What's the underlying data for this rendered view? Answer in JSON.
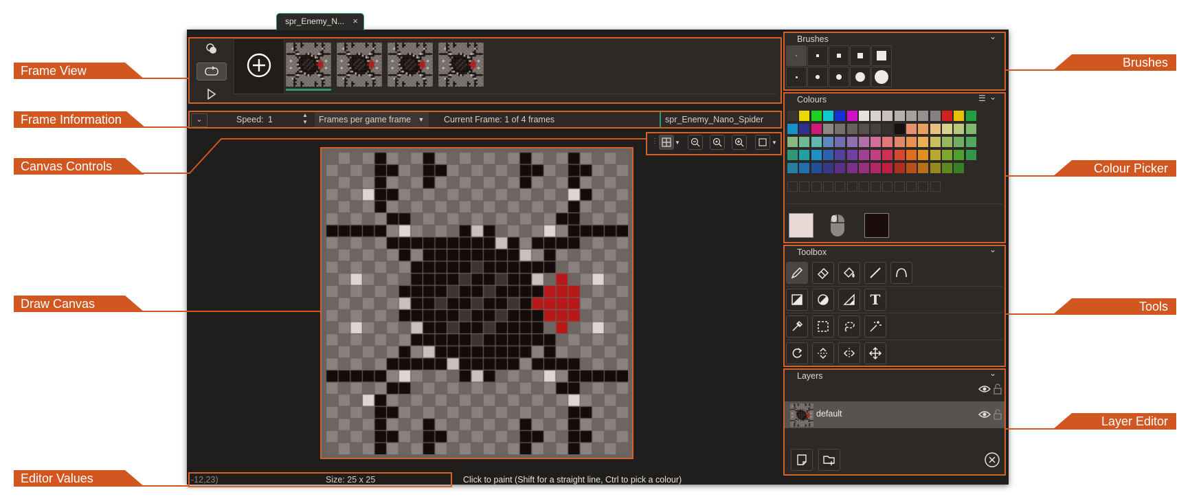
{
  "tab": {
    "title": "spr_Enemy_N...",
    "close": "×"
  },
  "callouts": {
    "frame_view": "Frame View",
    "frame_information": "Frame Information",
    "canvas_controls": "Canvas Controls",
    "draw_canvas": "Draw Canvas",
    "editor_values": "Editor Values",
    "brushes": "Brushes",
    "colour_picker": "Colour Picker",
    "tools": "Tools",
    "layer_editor": "Layer Editor"
  },
  "frame_info": {
    "speed_label": "Speed:",
    "speed_value": "1",
    "speed_mode": "Frames per game frame",
    "current_frame": "Current Frame: 1 of 4 frames",
    "sprite_name": "spr_Enemy_Nano_Spider"
  },
  "frame_view": {
    "frame_count": 4,
    "selected_frame": 1
  },
  "panels": {
    "brushes": "Brushes",
    "colours": "Colours",
    "toolbox": "Toolbox",
    "layers": "Layers"
  },
  "layers": [
    {
      "name": "default",
      "visible": true,
      "locked": false
    }
  ],
  "status": {
    "cursor": "-12,23)",
    "size": "Size: 25 x 25",
    "hint": "Click to paint (Shift for a straight line, Ctrl to pick a colour)"
  },
  "colours": {
    "palette": [
      [
        "#3a3532",
        "#e8d800",
        "#20d020",
        "#10c8d0",
        "#1830d8",
        "#d010c8",
        "#e8e0dc",
        "#d8d0cc",
        "#c8c0bc",
        "#b8b0ac",
        "#a8a09c",
        "#989090",
        "#888080",
        "#d02020",
        "#e8c000",
        "#20a040"
      ],
      [
        "#1890c8",
        "#303090",
        "#d01878",
        "#908888",
        "#787070",
        "#686060",
        "#585050",
        "#484040",
        "#383030",
        "#181010",
        "#e89070",
        "#e8a060",
        "#e8c080",
        "#d8d090",
        "#b8c880",
        "#80b870"
      ],
      [
        "#88b880",
        "#70b890",
        "#60b8b0",
        "#6088c0",
        "#7070b0",
        "#9070b0",
        "#b070a8",
        "#d07098",
        "#e07878",
        "#e08868",
        "#e89050",
        "#e8b050",
        "#c8c060",
        "#98b860",
        "#70b060",
        "#50a860"
      ],
      [
        "#309878",
        "#20a0a0",
        "#2090c8",
        "#3060b0",
        "#5040a0",
        "#7040a0",
        "#a04098",
        "#c04080",
        "#d03050",
        "#d84830",
        "#e07020",
        "#e09020",
        "#b8a830",
        "#80a830",
        "#50a030",
        "#309848"
      ],
      [
        "#2880a0",
        "#2070b0",
        "#205098",
        "#383888",
        "#583088",
        "#783088",
        "#983080",
        "#b02868",
        "#c02040",
        "#b03020",
        "#b85018",
        "#b87018",
        "#988820",
        "#608820",
        "#388028"
      ]
    ],
    "primary": "#ead8d4",
    "secondary": "#1a0c0a",
    "accent": "#d2561f"
  },
  "icons": {
    "onion_skin": "onion-skin-icon",
    "loop": "loop-icon",
    "play": "play-icon",
    "add_frame": "add-frame-icon"
  }
}
